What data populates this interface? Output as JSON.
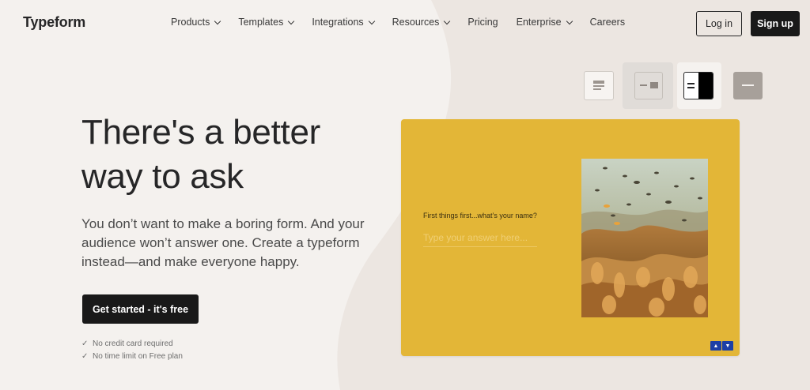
{
  "brand": {
    "logo": "Typeform"
  },
  "nav": {
    "items": [
      {
        "label": "Products",
        "dropdown": true
      },
      {
        "label": "Templates",
        "dropdown": true
      },
      {
        "label": "Integrations",
        "dropdown": true
      },
      {
        "label": "Resources",
        "dropdown": true
      },
      {
        "label": "Pricing",
        "dropdown": false
      },
      {
        "label": "Enterprise",
        "dropdown": true
      },
      {
        "label": "Careers",
        "dropdown": false
      }
    ],
    "login_label": "Log in",
    "signup_label": "Sign up"
  },
  "hero": {
    "title": "There's a better way to ask",
    "subtitle": "You don’t want to make a boring form. And your audience won’t answer one. Create a typeform instead—and make everyone happy.",
    "cta_label": "Get started - it's free",
    "checks": [
      {
        "mark": "✓",
        "text": "No credit card required"
      },
      {
        "mark": "✓",
        "text": "No time limit on Free plan"
      }
    ]
  },
  "layout_options": [
    {
      "name": "layout-stack",
      "icon": "layout-stack-icon"
    },
    {
      "name": "layout-split",
      "icon": "layout-split-icon"
    },
    {
      "name": "layout-split-right-dark",
      "icon": "layout-split-right-icon"
    },
    {
      "name": "layout-wallpaper",
      "icon": "layout-wallpaper-icon"
    }
  ],
  "form_preview": {
    "question": "First things first...what’s your name?",
    "answer_placeholder": "Type your answer here...",
    "up_arrow": "▲",
    "down_arrow": "▼",
    "image": "coral-reef-photo"
  },
  "colors": {
    "background": "#f4f1ee",
    "card": "#e3b637",
    "button_dark": "#191919",
    "nav_arrow": "#1d3fa6"
  }
}
